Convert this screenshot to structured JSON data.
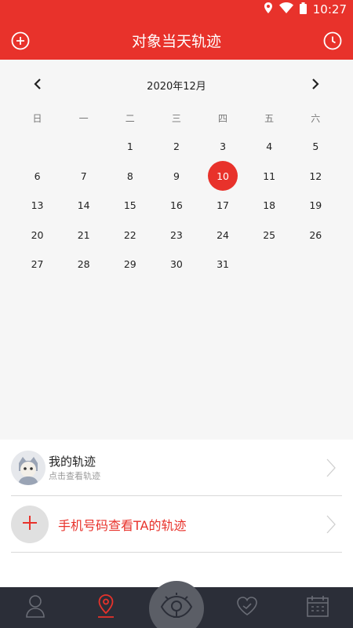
{
  "status": {
    "time": "10:27",
    "icons": [
      "location-icon",
      "wifi-icon",
      "battery-icon"
    ]
  },
  "appbar": {
    "title": "对象当天轨迹",
    "left_icon": "add-circle-icon",
    "right_icon": "clock-icon",
    "color": "#e8322b"
  },
  "calendar": {
    "month_label": "2020年12月",
    "weekdays": [
      "日",
      "一",
      "二",
      "三",
      "四",
      "五",
      "六"
    ],
    "days": [
      "",
      "",
      "1",
      "2",
      "3",
      "4",
      "5",
      "6",
      "7",
      "8",
      "9",
      "10",
      "11",
      "12",
      "13",
      "14",
      "15",
      "16",
      "17",
      "18",
      "19",
      "20",
      "21",
      "22",
      "23",
      "24",
      "25",
      "26",
      "27",
      "28",
      "29",
      "30",
      "31",
      "",
      ""
    ],
    "selected_day": "10"
  },
  "list": {
    "my_track": {
      "title": "我的轨迹",
      "subtitle": "点击查看轨迹"
    },
    "phone_track": {
      "title": "手机号码查看TA的轨迹"
    }
  },
  "bottom_nav": {
    "items": [
      "person-icon",
      "location-pin-icon",
      "eye-icon",
      "heart-icon",
      "calendar-icon"
    ],
    "active": "location-pin-icon",
    "active_color": "#e8322b"
  }
}
